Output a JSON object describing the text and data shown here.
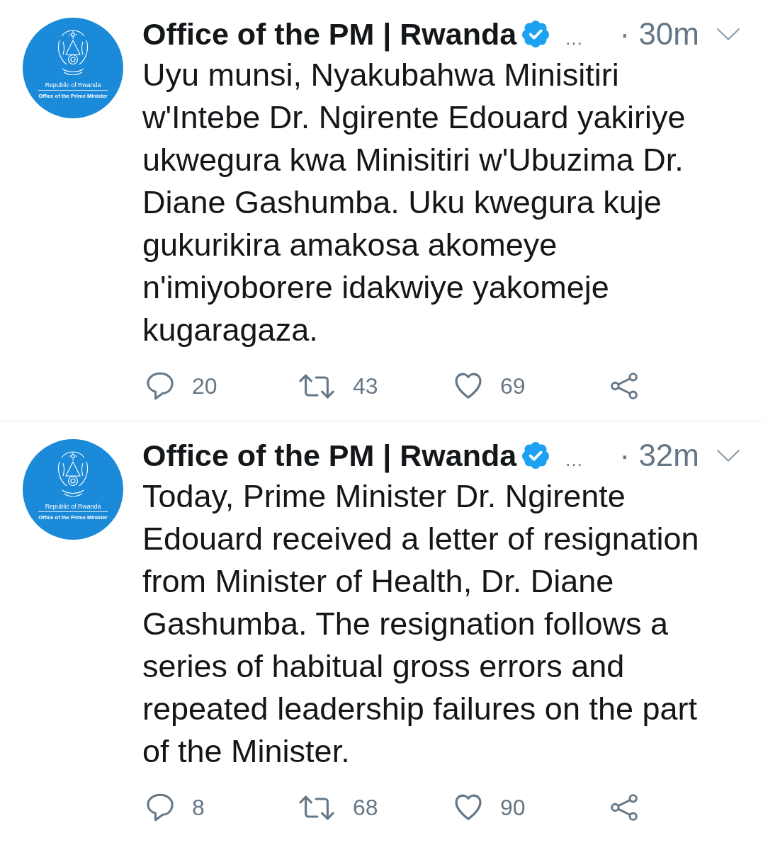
{
  "tweets": [
    {
      "avatar": {
        "title": "Republic of Rwanda",
        "subtitle": "Office of the Prime Minister"
      },
      "author": "Office of the PM | Rwanda",
      "verified": true,
      "handle": "…",
      "time": "· 30m",
      "text": "Uyu munsi, Nyakubahwa Minisitiri w'Intebe Dr. Ngirente Edouard yakiriye ukwegura kwa Minisitiri w'Ubuzima Dr. Diane Gashumba. Uku kwegura kuje gukurikira amakosa akomeye n'imiyoborere idakwiye yakomeje kugaragaza.",
      "actions": [
        {
          "kind": "reply",
          "count": "20"
        },
        {
          "kind": "retweet",
          "count": "43"
        },
        {
          "kind": "like",
          "count": "69"
        },
        {
          "kind": "share"
        }
      ]
    },
    {
      "avatar": {
        "title": "Republic of Rwanda",
        "subtitle": "Office of the Prime Minister"
      },
      "author": "Office of the PM | Rwanda",
      "verified": true,
      "handle": "…",
      "time": "· 32m",
      "text": "Today, Prime Minister Dr. Ngirente Edouard received a letter of resignation from Minister of Health, Dr. Diane Gashumba. The resignation follows a series of habitual gross errors and repeated leadership failures on the part of the Minister.",
      "actions": [
        {
          "kind": "reply",
          "count": "8"
        },
        {
          "kind": "retweet",
          "count": "68"
        },
        {
          "kind": "like",
          "count": "90"
        },
        {
          "kind": "share"
        }
      ]
    }
  ]
}
